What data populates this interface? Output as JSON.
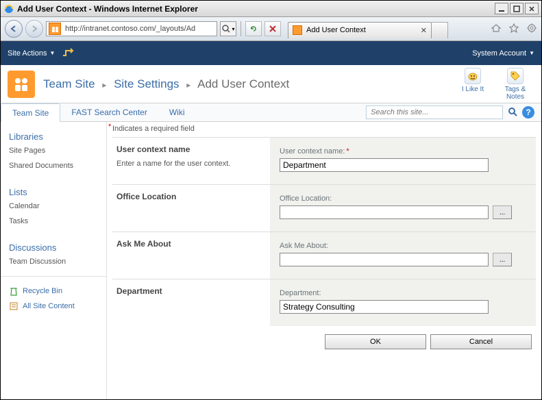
{
  "window": {
    "title": "Add User Context - Windows Internet Explorer"
  },
  "nav": {
    "url": "http://intranet.contoso.com/_layouts/Ad",
    "tab_label": "Add User Context"
  },
  "ribbon": {
    "site_actions": "Site Actions",
    "system_account": "System Account"
  },
  "breadcrumb": {
    "teamsite": "Team Site",
    "settings": "Site Settings",
    "current": "Add User Context"
  },
  "social": {
    "like": "I Like It",
    "tags": "Tags &\nNotes"
  },
  "topnav": {
    "items": [
      "Team Site",
      "FAST Search Center",
      "Wiki"
    ],
    "search_placeholder": "Search this site..."
  },
  "leftnav": {
    "libraries_head": "Libraries",
    "libraries": [
      "Site Pages",
      "Shared Documents"
    ],
    "lists_head": "Lists",
    "lists": [
      "Calendar",
      "Tasks"
    ],
    "discussions_head": "Discussions",
    "discussions": [
      "Team Discussion"
    ],
    "recycle": "Recycle Bin",
    "all_content": "All Site Content"
  },
  "hint": "Indicates a required field",
  "sections": {
    "name": {
      "title": "User context name",
      "desc": "Enter a name for the user context.",
      "label": "User context name:",
      "value": "Department"
    },
    "office": {
      "title": "Office Location",
      "label": "Office Location:",
      "value": ""
    },
    "ask": {
      "title": "Ask Me About",
      "label": "Ask Me About:",
      "value": ""
    },
    "dept": {
      "title": "Department",
      "label": "Department:",
      "value": "Strategy Consulting"
    }
  },
  "buttons": {
    "ok": "OK",
    "cancel": "Cancel"
  }
}
